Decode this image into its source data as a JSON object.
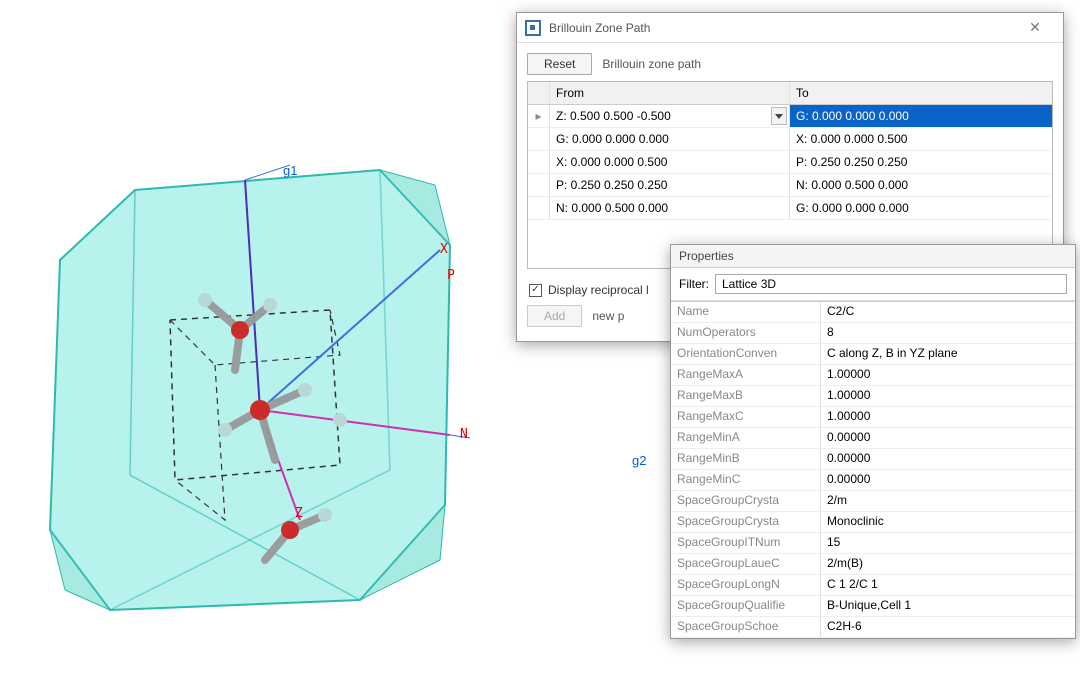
{
  "bzDialog": {
    "title": "Brillouin Zone Path",
    "resetLabel": "Reset",
    "topLabel": "Brillouin zone path",
    "headers": {
      "from": "From",
      "to": "To"
    },
    "rows": [
      {
        "from": "Z:  0.500  0.500  -0.500",
        "to": "G:  0.000  0.000  0.000",
        "selected": true
      },
      {
        "from": "G:  0.000  0.000  0.000",
        "to": "X:  0.000  0.000  0.500"
      },
      {
        "from": "X:  0.000  0.000  0.500",
        "to": "P:  0.250  0.250  0.250"
      },
      {
        "from": "P:  0.250  0.250  0.250",
        "to": "N:  0.000  0.500  0.000"
      },
      {
        "from": "N:  0.000  0.500  0.000",
        "to": "G:  0.000  0.000  0.000"
      }
    ],
    "checkboxLabel": "Display reciprocal l",
    "checkboxChecked": true,
    "addLabel": "Add",
    "newLabel": "new p"
  },
  "propsPanel": {
    "title": "Properties",
    "filterLabel": "Filter:",
    "filterValue": "Lattice 3D",
    "rows": [
      {
        "k": "Name",
        "v": "C2/C"
      },
      {
        "k": "NumOperators",
        "v": "8"
      },
      {
        "k": "OrientationConven",
        "v": "C along Z, B in YZ plane"
      },
      {
        "k": "RangeMaxA",
        "v": "1.00000"
      },
      {
        "k": "RangeMaxB",
        "v": "1.00000"
      },
      {
        "k": "RangeMaxC",
        "v": "1.00000"
      },
      {
        "k": "RangeMinA",
        "v": "0.00000"
      },
      {
        "k": "RangeMinB",
        "v": "0.00000"
      },
      {
        "k": "RangeMinC",
        "v": "0.00000"
      },
      {
        "k": "SpaceGroupCrysta",
        "v": "2/m"
      },
      {
        "k": "SpaceGroupCrysta",
        "v": "Monoclinic"
      },
      {
        "k": "SpaceGroupITNum",
        "v": "15"
      },
      {
        "k": "SpaceGroupLaueC",
        "v": "2/m(B)"
      },
      {
        "k": "SpaceGroupLongN",
        "v": "C 1 2/C 1"
      },
      {
        "k": "SpaceGroupQualifie",
        "v": "B-Unique,Cell 1"
      },
      {
        "k": "SpaceGroupSchoe",
        "v": "C2H-6"
      }
    ]
  },
  "viewport": {
    "labels": {
      "g1": "g1",
      "g2": "g2",
      "X": "X",
      "P": "P",
      "N": "N",
      "Z": "Z"
    }
  }
}
